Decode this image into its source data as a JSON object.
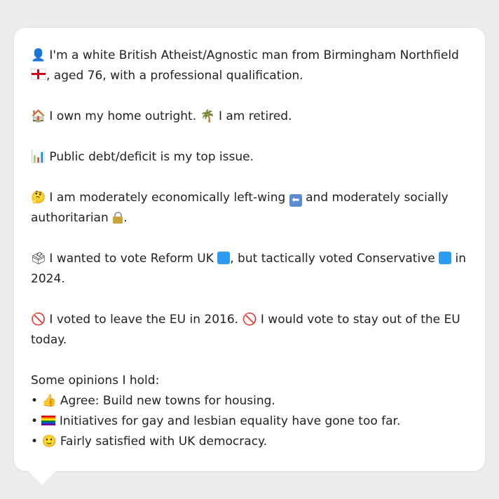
{
  "identity": {
    "part1": "I'm a white British Atheist/Agnostic man from Birmingham Northfield",
    "part2": ", aged 76, with a professional qualification."
  },
  "home": {
    "part1": "I own my home outright.",
    "part2": "I am retired."
  },
  "issue": "Public debt/deficit is my top issue.",
  "economics": {
    "part1": "I am moderately economically left-wing",
    "part2": "and moderately socially authoritarian",
    "part3": "."
  },
  "vote": {
    "part1": "I wanted to vote Reform UK",
    "part2": ", but tactically voted Conservative",
    "part3": "in 2024."
  },
  "brexit": {
    "part1": "I voted to leave the EU in 2016.",
    "part2": "I would vote to stay out of the EU today."
  },
  "opinions": {
    "heading": "Some opinions I hold:",
    "bullet": "•",
    "items": [
      "Agree: Build new towns for housing.",
      "Initiatives for gay and lesbian equality have gone too far.",
      "Fairly satisfied with UK democracy."
    ]
  },
  "icons": {
    "person": "person-silhouette-icon",
    "england_flag": "england-flag-icon",
    "house": "house-icon",
    "palm": "palm-tree-icon",
    "chart": "bar-chart-icon",
    "thinking": "thinking-face-icon",
    "left_arrow": "left-arrow-icon",
    "lock": "lock-icon",
    "ballot": "ballot-box-icon",
    "no_entry": "prohibited-icon",
    "thumbs_up": "thumbs-up-icon",
    "rainbow_flag": "rainbow-flag-icon",
    "smile": "slight-smile-icon"
  },
  "colors": {
    "background": "#eaecee",
    "bubble": "#ffffff",
    "text": "#222222",
    "party_square": "#2d9bf0"
  }
}
